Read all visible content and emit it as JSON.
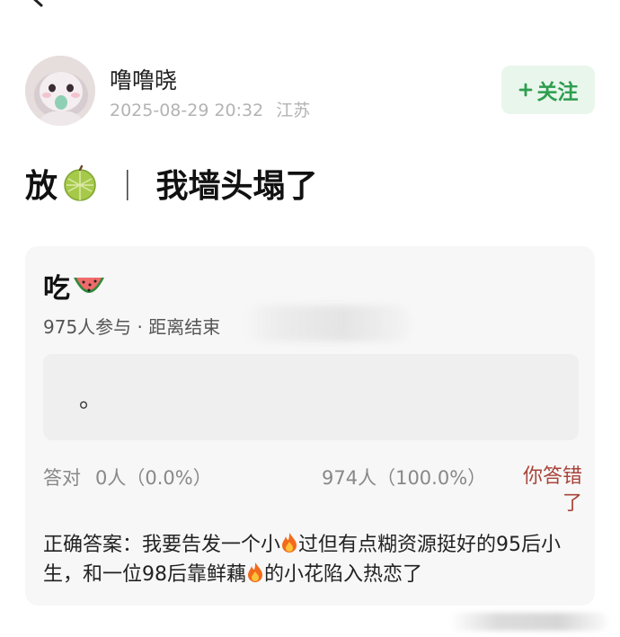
{
  "nav": {
    "back_icon": "chevron-left-icon"
  },
  "author": {
    "name": "噜噜晓",
    "date": "2025-08-29 20:32",
    "location": "江苏",
    "follow_label": "关注",
    "follow_icon": "plus-icon"
  },
  "post": {
    "title_start": "放",
    "title_emoji": "melon-emoji-icon",
    "title_separator": "|",
    "title_end": "我墙头塌了"
  },
  "quiz": {
    "question": "吃",
    "question_emoji": "watermelon-emoji-icon",
    "participants": "975人参与",
    "meta_separator": "·",
    "deadline_label": "距离结束",
    "option_text": "。",
    "correct_label": "答对",
    "correct_count": "0人（0.0%）",
    "wrong_count": "974人（100.0%）",
    "you_wrong_label": "你答错了",
    "answer_part1": "正确答案：我要告发一个小",
    "answer_part2": "过但有点糊资源挺好的95后小生，和一位98后靠鲜藕",
    "answer_part3": "的小花陷入热恋了"
  },
  "colors": {
    "follow_text": "#2e9e4f",
    "follow_bg": "#e9f6ec",
    "card_bg": "#f7f7f7",
    "wrong_text": "#a8443a"
  }
}
